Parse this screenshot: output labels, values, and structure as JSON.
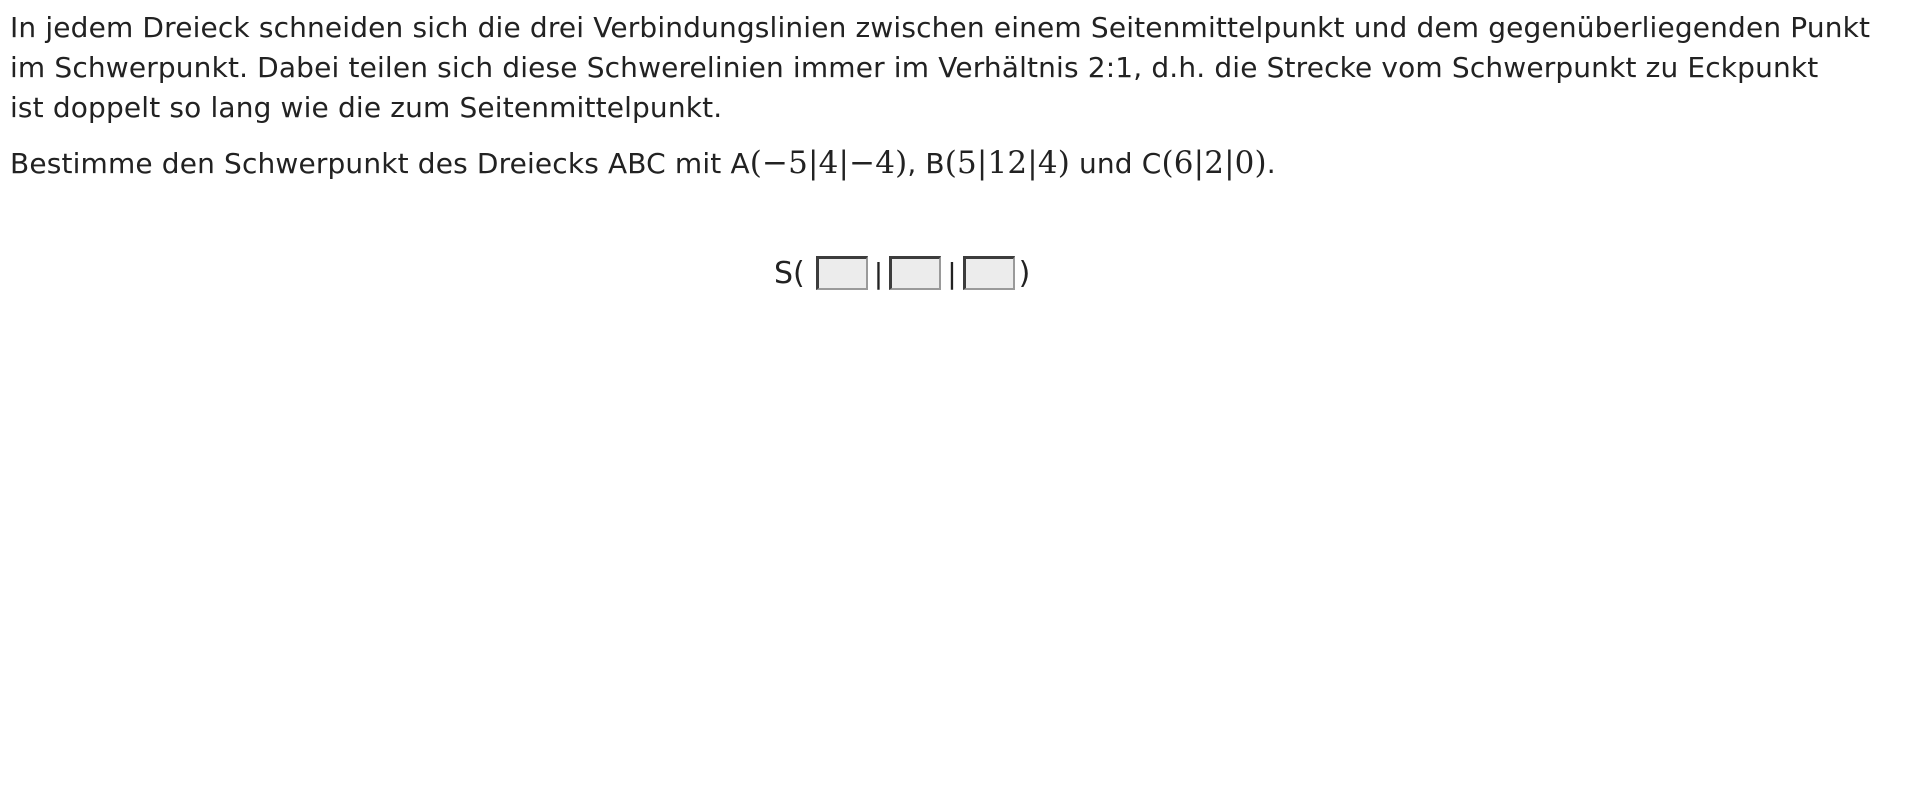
{
  "intro": {
    "line1": "In jedem Dreieck schneiden sich die drei Verbindungslinien zwischen einem Seitenmittelpunkt und dem gegenüberliegenden Punkt",
    "line2": "im Schwerpunkt. Dabei teilen sich diese Schwerelinien immer im Verhältnis 2:1, d.h. die Strecke vom Schwerpunkt zu Eckpunkt",
    "line3": "ist doppelt so lang wie die zum Seitenmittelpunkt."
  },
  "task": {
    "prefix": "Bestimme den Schwerpunkt des Dreiecks ABC mit A",
    "point_a": "(−5|4|−4)",
    "sep1": ", B",
    "point_b": "(5|12|4)",
    "sep2": " und C",
    "point_c": "(6|2|0)",
    "suffix": "."
  },
  "answer": {
    "label": "S(",
    "separator": "|",
    "close": ")",
    "x_value": "",
    "y_value": "",
    "z_value": ""
  }
}
